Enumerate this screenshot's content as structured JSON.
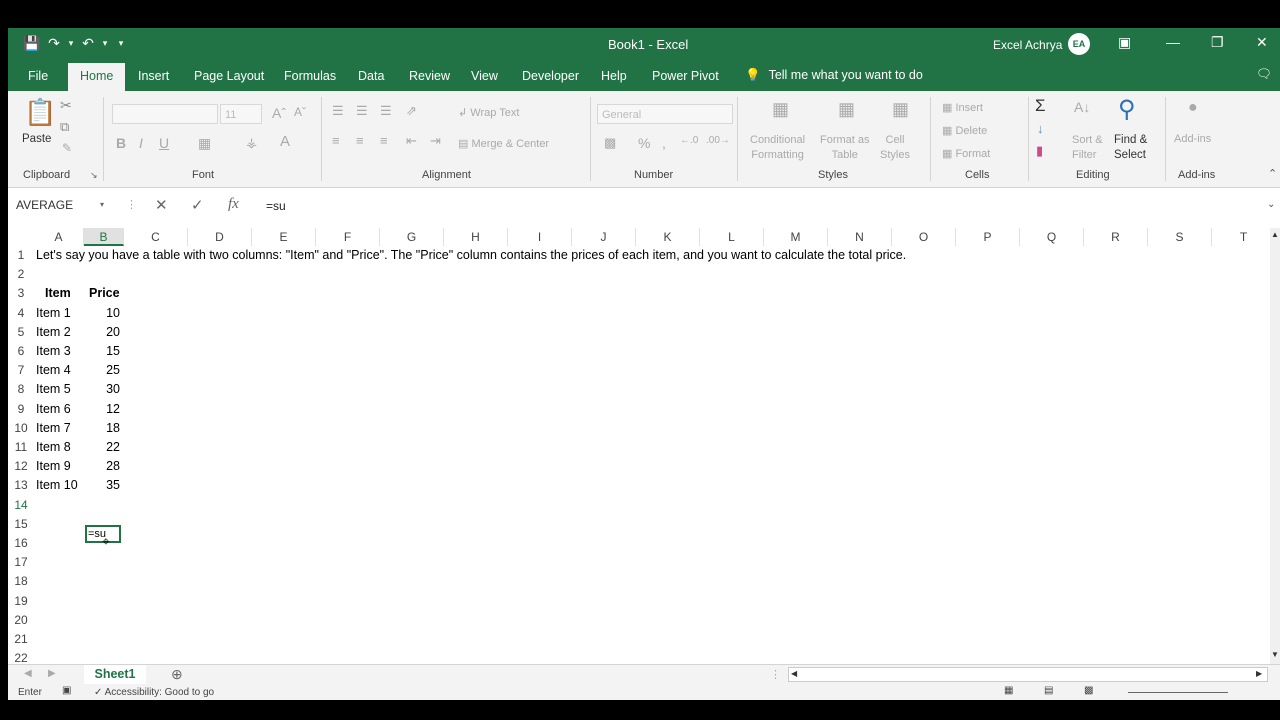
{
  "window": {
    "title": "Book1  -  Excel",
    "user": "Excel Achrya",
    "avatar_initials": "EA",
    "accent": "#217346"
  },
  "qat": {
    "save_icon": "save-icon",
    "redo_icon": "redo-icon",
    "undo_icon": "undo-icon"
  },
  "tabs": [
    "File",
    "Home",
    "Insert",
    "Page Layout",
    "Formulas",
    "Data",
    "Review",
    "View",
    "Developer",
    "Help",
    "Power Pivot"
  ],
  "tell_me": "Tell me what you want to do",
  "ribbon": {
    "clipboard": {
      "label": "Clipboard",
      "paste": "Paste"
    },
    "font": {
      "label": "Font",
      "size": "11"
    },
    "alignment": {
      "label": "Alignment",
      "wrap": "Wrap Text",
      "merge": "Merge & Center"
    },
    "number": {
      "label": "Number",
      "format": "General"
    },
    "styles": {
      "label": "Styles",
      "conditional": "Conditional",
      "formatting": "Formatting",
      "format_as": "Format as",
      "table": "Table",
      "cell": "Cell",
      "cell_styles": "Styles"
    },
    "cells": {
      "label": "Cells",
      "insert": "Insert",
      "delete": "Delete",
      "format": "Format"
    },
    "editing": {
      "label": "Editing",
      "sort": "Sort &",
      "filter": "Filter",
      "find": "Find &",
      "select": "Select"
    },
    "addins": {
      "label": "Add-ins",
      "addins_btn": "Add-ins"
    }
  },
  "formula_bar": {
    "name_box": "AVERAGE",
    "value": "=su"
  },
  "columns": [
    "A",
    "B",
    "C",
    "D",
    "E",
    "F",
    "G",
    "H",
    "I",
    "J",
    "K",
    "L",
    "M",
    "N",
    "O",
    "P",
    "Q",
    "R",
    "S",
    "T"
  ],
  "rows": [
    "1",
    "2",
    "3",
    "4",
    "5",
    "6",
    "7",
    "8",
    "9",
    "10",
    "11",
    "12",
    "13",
    "14",
    "15",
    "16",
    "17",
    "18",
    "19",
    "20",
    "21",
    "22"
  ],
  "sheet": {
    "a1": "Let's say you have a table with two columns: \"Item\" and \"Price\". The \"Price\" column contains the prices of each item, and you want to calculate the total price.",
    "header_item": "Item",
    "header_price": "Price",
    "items": [
      "Item 1",
      "Item 2",
      "Item 3",
      "Item 4",
      "Item 5",
      "Item 6",
      "Item 7",
      "Item 8",
      "Item 9",
      "Item 10"
    ],
    "prices": [
      "10",
      "20",
      "15",
      "25",
      "30",
      "12",
      "18",
      "22",
      "28",
      "35"
    ],
    "editing_value": "=su"
  },
  "sheet_tabs": [
    "Sheet1"
  ],
  "status": {
    "mode": "Enter",
    "accessibility": "Accessibility: Good to go"
  }
}
